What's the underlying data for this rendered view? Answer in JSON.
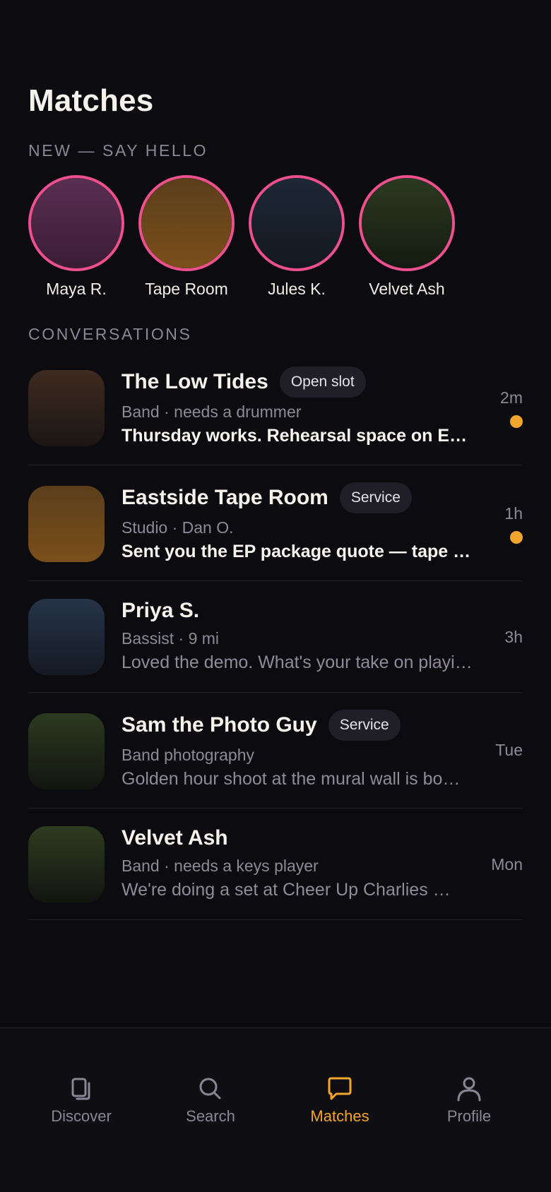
{
  "header": {
    "title": "Matches"
  },
  "new_matches": {
    "label": "NEW — SAY HELLO",
    "items": [
      {
        "name": "Maya R.",
        "color_top": "#5a2f52",
        "color_bottom": "#3a1c35"
      },
      {
        "name": "Tape Room",
        "color_top": "#5b3e1c",
        "color_bottom": "#7a4f1a"
      },
      {
        "name": "Jules K.",
        "color_top": "#1e2836",
        "color_bottom": "#131820"
      },
      {
        "name": "Velvet Ash",
        "color_top": "#2c3a20",
        "color_bottom": "#141a10"
      }
    ]
  },
  "conversations": {
    "label": "CONVERSATIONS",
    "items": [
      {
        "name": "The Low Tides",
        "badge": "Open slot",
        "subtitle": "Band · needs a drummer",
        "message": "Thursday works. Rehearsal space on E…",
        "time": "2m",
        "unread": true,
        "color_top": "#3e2a20",
        "color_bottom": "#1c1614"
      },
      {
        "name": "Eastside Tape Room",
        "badge": "Service",
        "subtitle": "Studio · Dan O.",
        "message": "Sent you the EP package quote — tape …",
        "time": "1h",
        "unread": true,
        "color_top": "#5b3e1c",
        "color_bottom": "#7a4f1a"
      },
      {
        "name": "Priya S.",
        "badge": "",
        "subtitle": "Bassist · 9 mi",
        "message": "Loved the demo. What's your take on playi…",
        "time": "3h",
        "unread": false,
        "color_top": "#263448",
        "color_bottom": "#141a24"
      },
      {
        "name": "Sam the Photo Guy",
        "badge": "Service",
        "subtitle": "Band photography",
        "message": "Golden hour shoot at the mural wall is bo…",
        "time": "Tue",
        "unread": false,
        "color_top": "#2c3a20",
        "color_bottom": "#121510"
      },
      {
        "name": "Velvet Ash",
        "badge": "",
        "subtitle": "Band · needs a keys player",
        "message": "We're doing a set at Cheer Up Charlies …",
        "time": "Mon",
        "unread": false,
        "color_top": "#2e3c20",
        "color_bottom": "#121510"
      }
    ]
  },
  "tabbar": {
    "items": [
      {
        "label": "Discover",
        "icon": "cards-icon",
        "active": false
      },
      {
        "label": "Search",
        "icon": "search-icon",
        "active": false
      },
      {
        "label": "Matches",
        "icon": "chat-bubble-icon",
        "active": true
      },
      {
        "label": "Profile",
        "icon": "person-icon",
        "active": false
      }
    ]
  },
  "colors": {
    "accent": "#f2a52d",
    "ring": "#ee4f8f",
    "background": "#0c0b0f"
  }
}
